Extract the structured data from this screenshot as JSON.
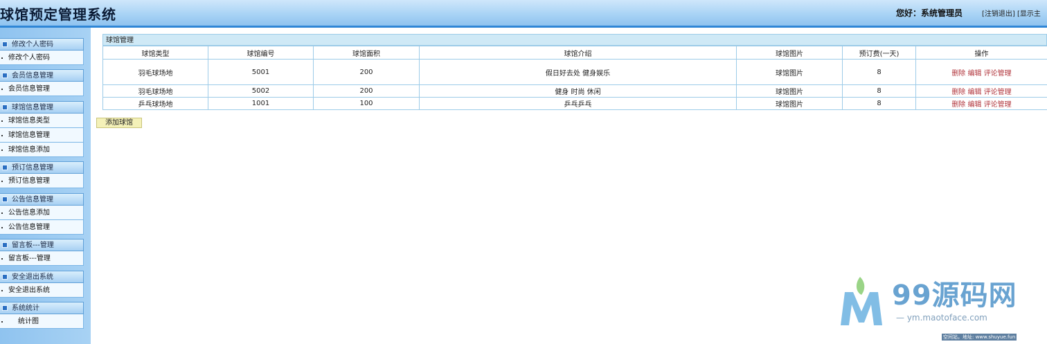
{
  "header": {
    "app_title": "球馆预定管理系统",
    "greeting": "您好：系统管理员",
    "logout_link": "[注销退出]",
    "home_link": "[显示主"
  },
  "sidebar": {
    "groups": [
      {
        "title": "修改个人密码",
        "items": [
          "修改个人密码"
        ]
      },
      {
        "title": "会员信息管理",
        "items": [
          "会员信息管理"
        ]
      },
      {
        "title": "球馆信息管理",
        "items": [
          "球馆信息类型",
          "球馆信息管理",
          "球馆信息添加"
        ]
      },
      {
        "title": "预订信息管理",
        "items": [
          "预订信息管理"
        ]
      },
      {
        "title": "公告信息管理",
        "items": [
          "公告信息添加",
          "公告信息管理"
        ]
      },
      {
        "title": "留言板---管理",
        "items": [
          "留言板---管理"
        ]
      },
      {
        "title": "安全退出系统",
        "items": [
          "安全退出系统"
        ]
      },
      {
        "title": "系统统计",
        "items": [
          "统计图"
        ]
      }
    ]
  },
  "panel": {
    "title": "球馆管理",
    "columns": [
      "球馆类型",
      "球馆编号",
      "球馆面积",
      "球馆介绍",
      "球馆图片",
      "预订费(一天)",
      "操作"
    ],
    "rows": [
      {
        "type": "羽毛球场地",
        "code": "5001",
        "area": "200",
        "intro": "假日好去处 健身娱乐",
        "image": "球馆图片",
        "fee": "8"
      },
      {
        "type": "羽毛球场地",
        "code": "5002",
        "area": "200",
        "intro": "健身 时尚 休闲",
        "image": "球馆图片",
        "fee": "8"
      },
      {
        "type": "乒乓球场地",
        "code": "1001",
        "area": "100",
        "intro": "乒乓乒乓",
        "image": "球馆图片",
        "fee": "8"
      }
    ],
    "actions": {
      "delete": "删除",
      "edit": "编辑",
      "review": "评论管理"
    },
    "add_button": "添加球馆"
  },
  "watermark": {
    "brand": "99源码网",
    "sub": "— ym.maotoface.com",
    "small": "空间站，地址: www.shuyue.fun"
  },
  "colors": {
    "header_accent": "#2f86d6",
    "sidebar_bg": "#a8d2f4",
    "action_link": "#b0333a",
    "add_button_bg": "#f4f1b8"
  }
}
